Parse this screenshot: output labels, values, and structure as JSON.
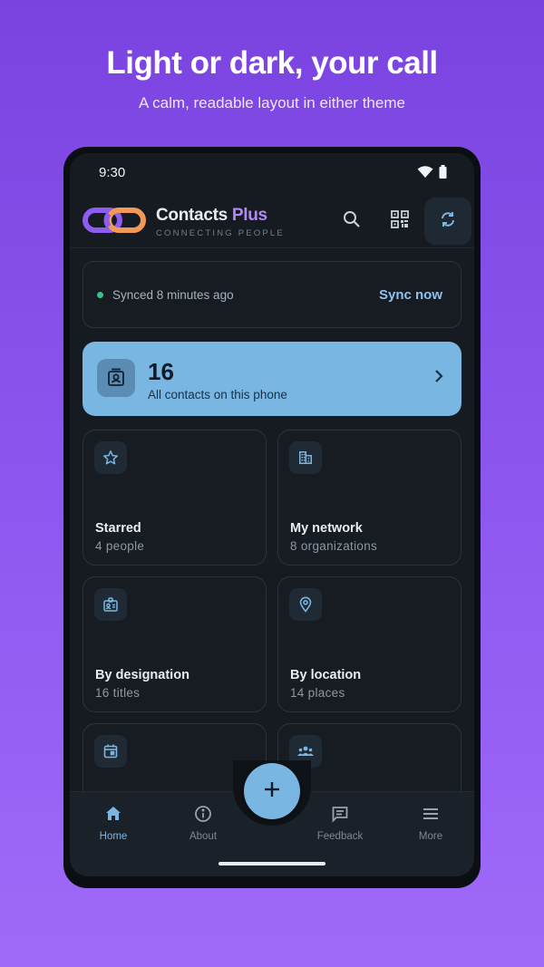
{
  "promo": {
    "title": "Light or dark, your call",
    "subtitle": "A calm, readable layout in either theme"
  },
  "status_bar": {
    "time": "9:30",
    "icons": [
      "wifi-icon",
      "battery-icon"
    ]
  },
  "app_bar": {
    "brand_name": "Contacts",
    "brand_plus": "Plus",
    "tagline": "CONNECTING PEOPLE",
    "actions": [
      "search-icon",
      "qr-code-icon",
      "sync-icon"
    ]
  },
  "sync": {
    "status": "Synced 8 minutes ago",
    "action": "Sync now",
    "status_color": "#37c489"
  },
  "all_contacts": {
    "count": "16",
    "label": "All contacts on this phone"
  },
  "tiles": [
    {
      "title": "Starred",
      "subtitle": "4 people",
      "icon": "star-icon"
    },
    {
      "title": "My network",
      "subtitle": "8 organizations",
      "icon": "building-icon"
    },
    {
      "title": "By designation",
      "subtitle": "16 titles",
      "icon": "id-badge-icon"
    },
    {
      "title": "By location",
      "subtitle": "14 places",
      "icon": "location-pin-icon"
    },
    {
      "title": "",
      "subtitle": "",
      "icon": "calendar-icon"
    },
    {
      "title": "",
      "subtitle": "",
      "icon": "group-icon"
    }
  ],
  "bottom_nav": {
    "items": [
      {
        "label": "Home",
        "icon": "home-icon",
        "active": true
      },
      {
        "label": "About",
        "icon": "info-icon",
        "active": false
      },
      {
        "label": "Feedback",
        "icon": "feedback-icon",
        "active": false
      },
      {
        "label": "More",
        "icon": "menu-icon",
        "active": false
      }
    ],
    "fab_icon": "plus-icon"
  },
  "colors": {
    "accent": "#7ab6e2",
    "brand_purple": "#b189f5",
    "background": "#161b22",
    "promo_gradient": "#7a43e0"
  }
}
